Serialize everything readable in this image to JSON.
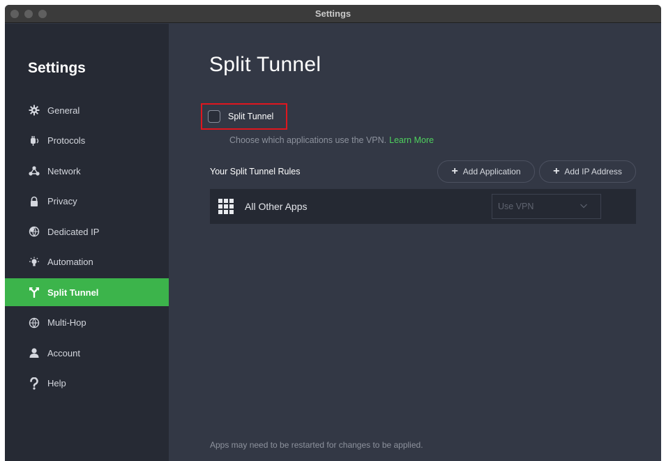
{
  "window": {
    "title": "Settings"
  },
  "sidebar": {
    "title": "Settings",
    "items": [
      {
        "label": "General",
        "icon": "gear-icon"
      },
      {
        "label": "Protocols",
        "icon": "protocols-icon"
      },
      {
        "label": "Network",
        "icon": "network-icon"
      },
      {
        "label": "Privacy",
        "icon": "lock-icon"
      },
      {
        "label": "Dedicated IP",
        "icon": "dedicated-ip-icon"
      },
      {
        "label": "Automation",
        "icon": "lightbulb-icon"
      },
      {
        "label": "Split Tunnel",
        "icon": "split-tunnel-icon",
        "active": true
      },
      {
        "label": "Multi-Hop",
        "icon": "globe-icon"
      },
      {
        "label": "Account",
        "icon": "user-icon"
      },
      {
        "label": "Help",
        "icon": "question-icon"
      }
    ]
  },
  "main": {
    "title": "Split Tunnel",
    "toggle_label": "Split Tunnel",
    "description": "Choose which applications use the VPN.",
    "learn_more": "Learn More",
    "rules_header": "Your Split Tunnel Rules",
    "add_application": "Add Application",
    "add_ip_address": "Add IP Address",
    "rules": [
      {
        "name": "All Other Apps",
        "value": "Use VPN"
      }
    ],
    "footer_note": "Apps may need to be restarted for changes to be applied."
  },
  "colors": {
    "accent": "#3cb44b",
    "link": "#4fd15e",
    "highlight": "#e0161e"
  }
}
